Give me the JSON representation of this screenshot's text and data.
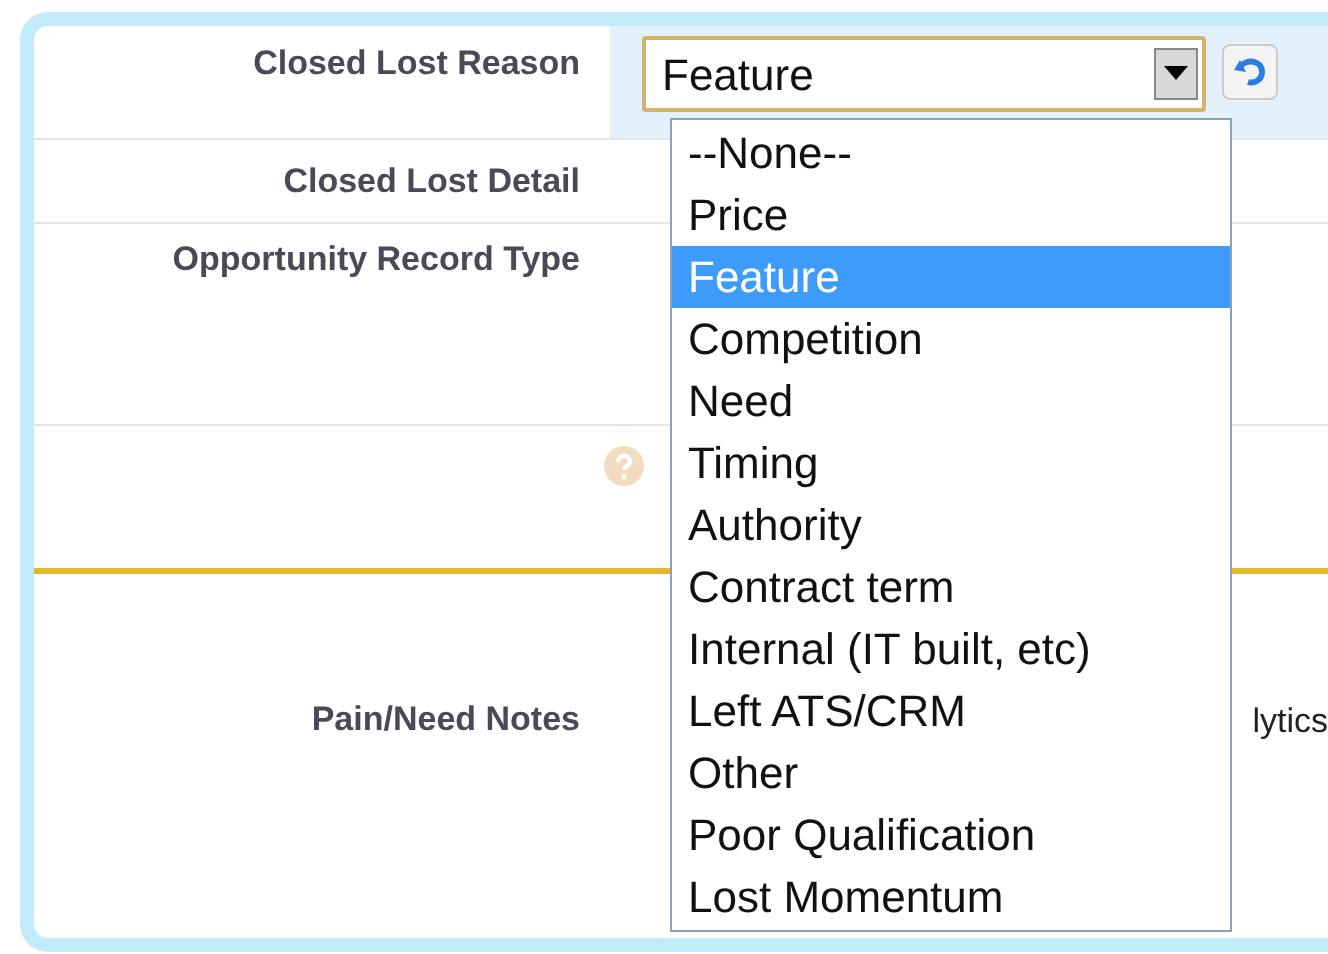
{
  "fields": [
    {
      "kind": "picklist",
      "label": "Closed Lost Reason",
      "value": "Feature",
      "highlighted": true
    },
    {
      "kind": "text",
      "label": "Closed Lost Detail"
    },
    {
      "kind": "text",
      "label": "Opportunity Record Type"
    },
    {
      "kind": "help"
    },
    {
      "kind": "notes",
      "label": "Pain/Need Notes",
      "value": "lytics"
    }
  ],
  "dropdown": {
    "options": [
      {
        "label": "--None--",
        "selected": false
      },
      {
        "label": "Price",
        "selected": false
      },
      {
        "label": "Feature",
        "selected": true
      },
      {
        "label": "Competition",
        "selected": false
      },
      {
        "label": "Need",
        "selected": false
      },
      {
        "label": "Timing",
        "selected": false
      },
      {
        "label": "Authority",
        "selected": false
      },
      {
        "label": "Contract term",
        "selected": false
      },
      {
        "label": "Internal (IT built, etc)",
        "selected": false
      },
      {
        "label": "Left ATS/CRM",
        "selected": false
      },
      {
        "label": "Other",
        "selected": false
      },
      {
        "label": "Poor Qualification",
        "selected": false
      },
      {
        "label": "Lost Momentum",
        "selected": false
      }
    ]
  }
}
